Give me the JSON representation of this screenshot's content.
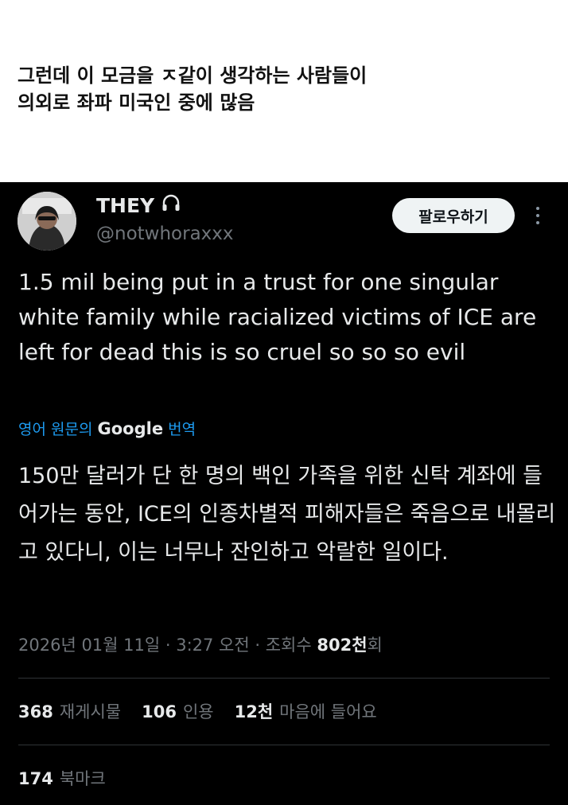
{
  "caption": {
    "line1": "그런데 이 모금을 ㅈ같이 생각하는 사람들이",
    "line2": "의외로 좌파 미국인 중에 많음"
  },
  "tweet": {
    "display_name": "THEY",
    "name_icon": "headphones-icon",
    "handle": "@notwhoraxxx",
    "follow_label": "팔로우하기",
    "text": "1.5 mil being put in a trust for one singular white family while racialized victims of ICE are left for dead this is so cruel so so so evil",
    "translate": {
      "prefix": "영어 원문의",
      "brand": "Google",
      "suffix": "번역"
    },
    "translated_text": "150만 달러가 단 한 명의 백인 가족을 위한 신탁 계좌에 들어가는 동안, ICE의 인종차별적 피해자들은 죽음으로 내몰리고 있다니, 이는 너무나 잔인하고 악랄한 일이다.",
    "meta": {
      "datetime": "2026년 01월 11일 · 3:27 오전 · 조회수",
      "views_value": "802천",
      "views_suffix": "회"
    },
    "stats": {
      "reposts_count": "368",
      "reposts_label": "재게시물",
      "quotes_count": "106",
      "quotes_label": "인용",
      "likes_count": "12천",
      "likes_label": "마음에 들어요",
      "bookmarks_count": "174",
      "bookmarks_label": "북마크"
    }
  },
  "colors": {
    "background": "#000000",
    "text": "#e7e9ea",
    "muted": "#71767b",
    "link": "#1d9bf0",
    "button_bg": "#eff3f4"
  }
}
